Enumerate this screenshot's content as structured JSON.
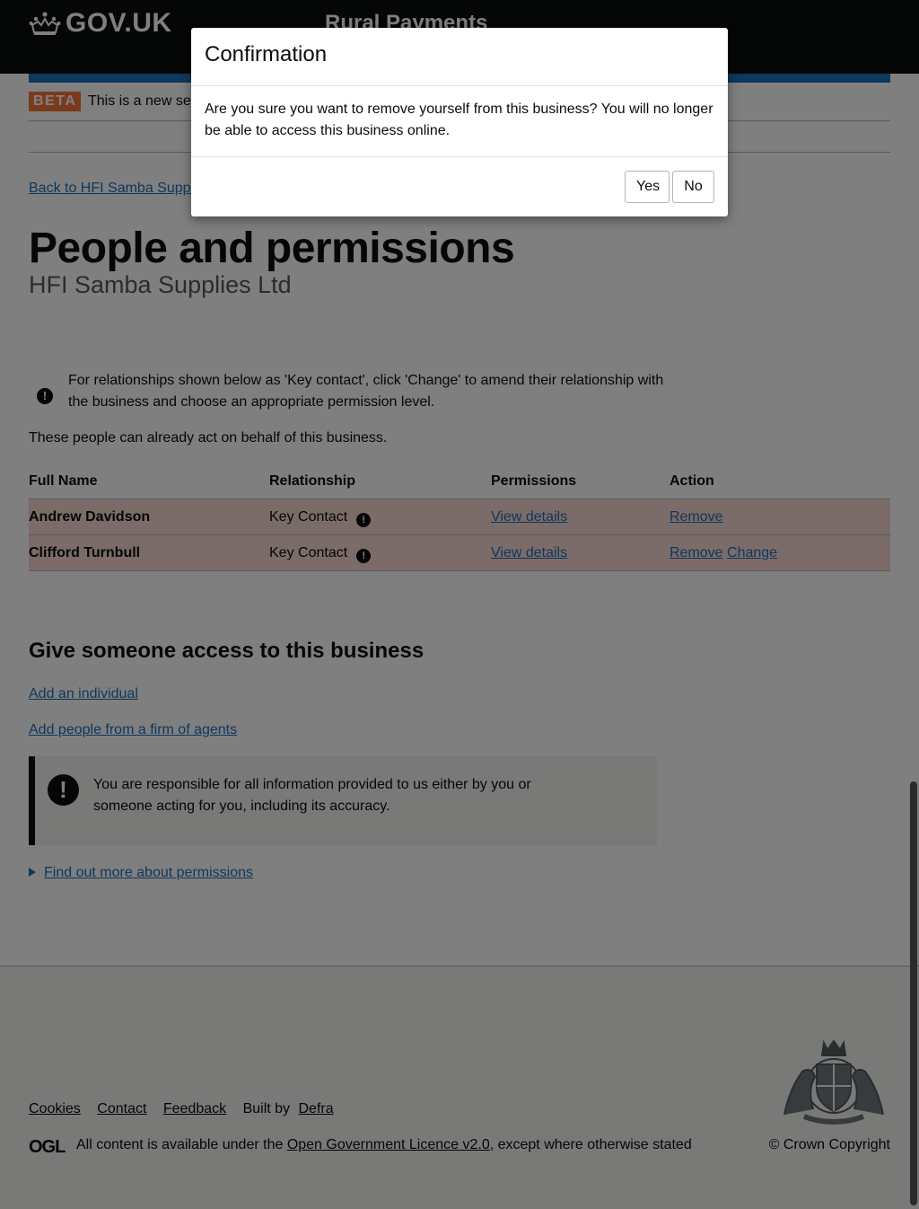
{
  "header": {
    "brand": "GOV.UK",
    "service": "Rural Payments"
  },
  "phase": {
    "tag": "BETA",
    "text": "This is a new serv"
  },
  "back_link": "Back to HFI Samba Supplie",
  "page": {
    "title": "People and permissions",
    "caption": "HFI Samba Supplies Ltd"
  },
  "notice": {
    "icon": "!",
    "text": "For relationships shown below as 'Key contact', click 'Change' to amend their relationship with the business and choose an appropriate permission level."
  },
  "intro": "These people can already act on behalf of this business.",
  "table": {
    "headers": [
      "Full Name",
      "Relationship",
      "Permissions",
      "Action"
    ],
    "rows": [
      {
        "name": "Andrew Davidson",
        "relationship": "Key Contact",
        "icon": "!",
        "permissions": "View details",
        "actions": [
          "Remove"
        ]
      },
      {
        "name": "Clifford Turnbull",
        "relationship": "Key Contact",
        "icon": "!",
        "permissions": "View details",
        "actions": [
          "Remove",
          "Change"
        ]
      }
    ]
  },
  "access": {
    "title": "Give someone access to this business",
    "add_individual": "Add an individual",
    "add_agents": "Add people from a firm of agents"
  },
  "warning": {
    "icon": "!",
    "text": "You are responsible for all information provided to us either by you or someone acting for you, including its accuracy."
  },
  "details_summary": "Find out more about permissions",
  "footer": {
    "links": [
      "Cookies",
      "Contact",
      "Feedback"
    ],
    "built_by_prefix": "Built by ",
    "built_by_link": "Defra",
    "ogl": "OGL",
    "licence_prefix": "All content is available under the ",
    "licence_link": "Open Government Licence v2.0",
    "licence_suffix": ", except where otherwise stated",
    "copyright": "© Crown Copyright"
  },
  "modal": {
    "title": "Confirmation",
    "body": "Are you sure you want to remove yourself from this business? You will no longer be able to access this business online.",
    "yes": "Yes",
    "no": "No"
  },
  "colors": {
    "header_bg": "#0b0c0c",
    "accent_blue": "#1d70b8",
    "beta_orange": "#f47738",
    "row_highlight": "#f6d7d2"
  }
}
